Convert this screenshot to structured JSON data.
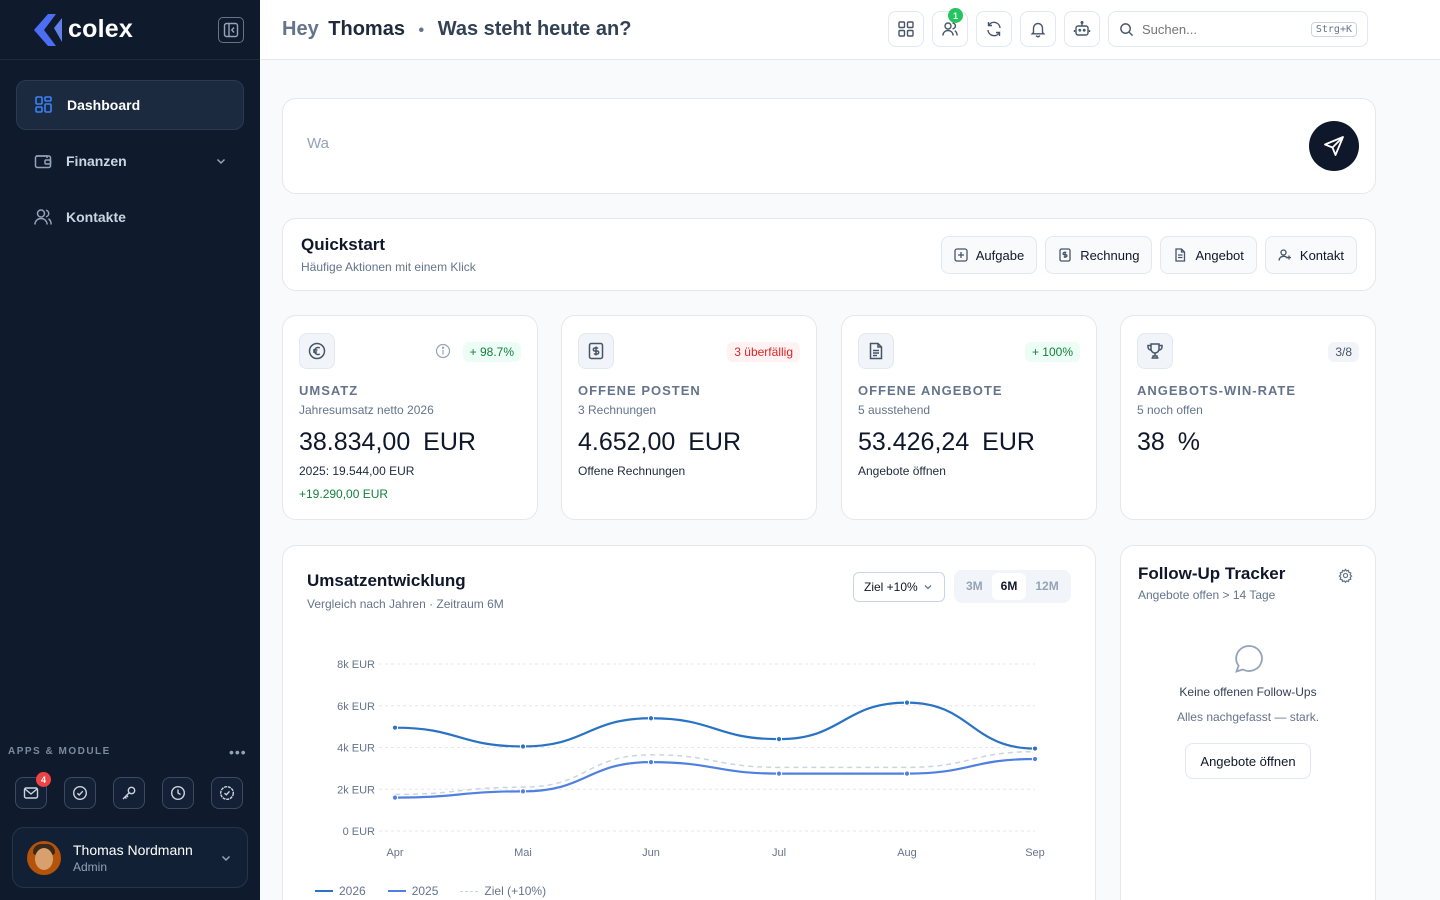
{
  "brand": {
    "name": "colex"
  },
  "sidebar": {
    "items": [
      {
        "label": "Dashboard",
        "icon": "dashboard-grid-icon"
      },
      {
        "label": "Finanzen",
        "icon": "wallet-icon"
      },
      {
        "label": "Kontakte",
        "icon": "users-icon"
      }
    ],
    "apps_label": "APPS & MODULE",
    "apps_more": "•••",
    "mail_badge": "4",
    "apps": [
      "mail-icon",
      "check-circle-icon",
      "key-icon",
      "clock-icon",
      "badge-check-icon"
    ]
  },
  "user": {
    "name": "Thomas Nordmann",
    "role": "Admin"
  },
  "header": {
    "greeting": "Hey",
    "name": "Thomas",
    "separator": "•",
    "question": "Was steht heute an?",
    "team_badge": "1",
    "search_placeholder": "Suchen...",
    "search_shortcut": "Strg+K"
  },
  "prompt": {
    "value": "Wa"
  },
  "quickstart": {
    "title": "Quickstart",
    "subtitle": "Häufige Aktionen mit einem Klick",
    "actions": [
      "Aufgabe",
      "Rechnung",
      "Angebot",
      "Kontakt"
    ]
  },
  "kpis": [
    {
      "badge": "+ 98.7%",
      "label": "UMSATZ",
      "desc": "Jahresumsatz netto 2026",
      "value": "38.834,00 EUR",
      "extra1": "2025: 19.544,00 EUR",
      "extra2": "+19.290,00 EUR"
    },
    {
      "badge": "3 überfällig",
      "label": "OFFENE POSTEN",
      "desc": "3 Rechnungen",
      "value": "4.652,00 EUR",
      "extra1": "Offene Rechnungen"
    },
    {
      "badge": "+ 100%",
      "label": "OFFENE ANGEBOTE",
      "desc": "5 ausstehend",
      "value": "53.426,24 EUR",
      "extra1": "Angebote öffnen"
    },
    {
      "badge": "3/8",
      "label": "ANGEBOTS-WIN-RATE",
      "desc": "5 noch offen",
      "value": "38 %"
    }
  ],
  "chart_section": {
    "title": "Umsatzentwicklung",
    "subtitle": "Vergleich nach Jahren · Zeitraum 6M",
    "target_select": "Ziel +10%",
    "ranges": [
      "3M",
      "6M",
      "12M"
    ],
    "active_range": "6M"
  },
  "chart_data": {
    "type": "line",
    "categories": [
      "Apr",
      "Mai",
      "Jun",
      "Jul",
      "Aug",
      "Sep"
    ],
    "y_ticks": [
      "0 EUR",
      "2k EUR",
      "4k EUR",
      "6k EUR",
      "8k EUR"
    ],
    "ylim": [
      0,
      8000
    ],
    "grid": true,
    "legend": "bottom-left",
    "series": [
      {
        "name": "2026",
        "values": [
          4950,
          4050,
          5400,
          4400,
          6150,
          3950
        ],
        "color": "#2a72c4",
        "style": "solid"
      },
      {
        "name": "2025",
        "values": [
          1600,
          1900,
          3300,
          2750,
          2750,
          3450
        ],
        "color": "#4f80e0",
        "style": "solid"
      },
      {
        "name": "Ziel (+10%)",
        "values": [
          1750,
          2100,
          3650,
          3050,
          3050,
          3800
        ],
        "color": "#cbd5e1",
        "style": "dashed"
      }
    ]
  },
  "followup": {
    "title": "Follow-Up Tracker",
    "subtitle": "Angebote offen > 14 Tage",
    "empty_title": "Keine offenen Follow-Ups",
    "empty_sub": "Alles nachgefasst — stark.",
    "button": "Angebote öffnen"
  },
  "colors": {
    "sidebar": "#0f1b2d",
    "accent": "#2563eb",
    "success": "#15803d",
    "danger": "#dc2626"
  }
}
